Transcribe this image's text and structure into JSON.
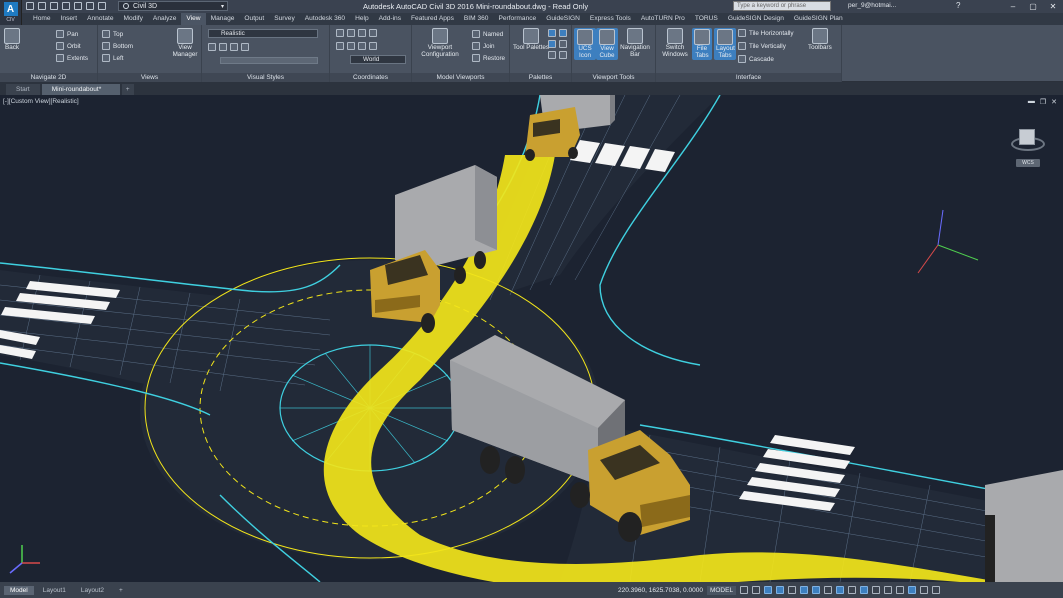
{
  "app": {
    "logo": "A",
    "logo_sub": "CIV",
    "workspace": "Civil 3D",
    "title": "Autodesk AutoCAD Civil 3D 2016    Mini-roundabout.dwg - Read Only",
    "search_placeholder": "Type a keyword or phrase",
    "user": "per_9@hotmai...",
    "help": "?"
  },
  "ribbon_tabs": [
    "Home",
    "Insert",
    "Annotate",
    "Modify",
    "Analyze",
    "View",
    "Manage",
    "Output",
    "Survey",
    "Autodesk 360",
    "Help",
    "Add-ins",
    "Featured Apps",
    "BIM 360",
    "Performance",
    "GuideSIGN",
    "Express Tools",
    "AutoTURN Pro",
    "TORUS",
    "GuideSIGN Design",
    "GuideSIGN Plan"
  ],
  "active_tab": "View",
  "ribbon": {
    "navigate2d": {
      "title": "Navigate 2D",
      "back": "Back",
      "pan": "Pan",
      "orbit": "Orbit",
      "extents": "Extents"
    },
    "views": {
      "title": "Views",
      "top": "Top",
      "bottom": "Bottom",
      "left": "Left",
      "view_manager": "View Manager"
    },
    "visual_styles": {
      "title": "Visual Styles",
      "style": "Realistic"
    },
    "coordinates": {
      "title": "Coordinates",
      "world": "World"
    },
    "model_viewports": {
      "title": "Model Viewports",
      "config": "Viewport Configuration",
      "named": "Named",
      "join": "Join",
      "restore": "Restore"
    },
    "palettes": {
      "title": "Palettes",
      "toolpalettes": "Tool Palettes"
    },
    "viewport_tools": {
      "title": "Viewport Tools",
      "ucs": "UCS Icon",
      "viewcube": "View Cube",
      "navbar": "Navigation Bar"
    },
    "interface": {
      "title": "Interface",
      "switch": "Switch Windows",
      "file_tabs": "File Tabs",
      "layout_tabs": "Layout Tabs",
      "tile_h": "Tile Horizontally",
      "tile_v": "Tile Vertically",
      "cascade": "Cascade",
      "toolbars": "Toolbars"
    }
  },
  "doc_tabs": [
    "Start",
    "Mini-roundabout*",
    "+"
  ],
  "viewport": {
    "label": "[-][Custom View][Realistic]",
    "viewcube_label": "WCS"
  },
  "layout_tabs": [
    "Model",
    "Layout1",
    "Layout2",
    "+"
  ],
  "status": {
    "coords": "220.3960, 1625.7038, 0.0000",
    "model": "MODEL"
  },
  "colors": {
    "road_paint": "#f2e51a",
    "kerb_line": "#3fd0e0",
    "truck_cab": "#c9a030",
    "truck_box": "#a9aaad"
  }
}
